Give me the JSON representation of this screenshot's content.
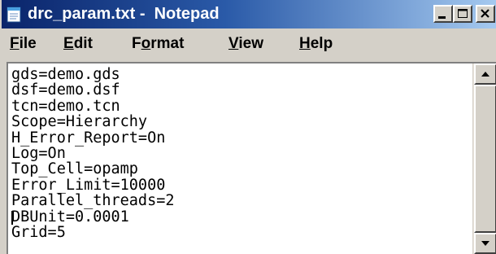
{
  "window": {
    "title": "drc_param.txt -  Notepad",
    "icons": {
      "app": "notepad-icon",
      "minimize": "minimize-icon",
      "maximize": "maximize-icon",
      "close": "close-icon"
    }
  },
  "menu": {
    "items": [
      {
        "label": "File"
      },
      {
        "label": "Edit"
      },
      {
        "label": "Format"
      },
      {
        "label": "View"
      },
      {
        "label": "Help"
      }
    ]
  },
  "editor": {
    "content": "gds=demo.gds\ndsf=demo.dsf\ntcn=demo.tcn\nScope=Hierarchy\nH_Error_Report=On\nLog=On\nTop_Cell=opamp\nError_Limit=10000\nParallel_threads=2\nDBUnit=0.0001\nGrid=5"
  },
  "scrollbar": {
    "up_icon": "arrow-up-icon",
    "down_icon": "arrow-down-icon"
  }
}
